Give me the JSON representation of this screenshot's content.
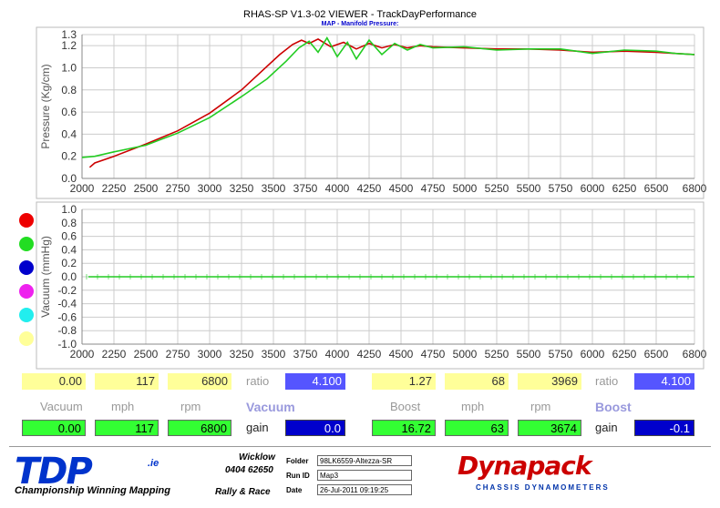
{
  "window": {
    "title": "RHAS-SP V1.3-02 VIEWER - TrackDayPerformance",
    "subtitle": "MAP - Manifold Pressure:"
  },
  "chart_data": [
    {
      "type": "line",
      "ylabel": "Pressure (Kg/cm)",
      "xlim": [
        2000,
        6800
      ],
      "ylim": [
        0.0,
        1.3
      ],
      "x_ticks": [
        2000,
        2250,
        2500,
        2750,
        3000,
        3250,
        3500,
        3750,
        4000,
        4250,
        4500,
        4750,
        5000,
        5250,
        5500,
        5750,
        6000,
        6250,
        6500,
        6800
      ],
      "y_ticks": [
        "0.0",
        "0.2",
        "0.4",
        "0.6",
        "0.8",
        "1.0",
        "1.2",
        "1.3"
      ],
      "y_tick_values": [
        0.0,
        0.2,
        0.4,
        0.6,
        0.8,
        1.0,
        1.2,
        1.3
      ],
      "grid": true,
      "series": [
        {
          "color": "#cc0000",
          "x": [
            2060,
            2100,
            2250,
            2500,
            2750,
            3000,
            3250,
            3400,
            3550,
            3650,
            3720,
            3780,
            3850,
            3950,
            4050,
            4150,
            4250,
            4350,
            4450,
            4550,
            4650,
            4750,
            5000,
            5250,
            5500,
            5750,
            6000,
            6250,
            6500,
            6650,
            6800
          ],
          "y": [
            0.1,
            0.14,
            0.2,
            0.31,
            0.43,
            0.59,
            0.8,
            0.96,
            1.12,
            1.21,
            1.25,
            1.22,
            1.26,
            1.19,
            1.23,
            1.17,
            1.22,
            1.18,
            1.21,
            1.18,
            1.2,
            1.19,
            1.18,
            1.17,
            1.17,
            1.16,
            1.14,
            1.15,
            1.14,
            1.13,
            1.12
          ]
        },
        {
          "color": "#22cc22",
          "x": [
            2000,
            2100,
            2250,
            2500,
            2750,
            3000,
            3250,
            3450,
            3600,
            3700,
            3780,
            3850,
            3920,
            4000,
            4080,
            4150,
            4250,
            4350,
            4450,
            4550,
            4650,
            4750,
            5000,
            5250,
            5500,
            5750,
            6000,
            6250,
            6500,
            6650,
            6800
          ],
          "y": [
            0.19,
            0.2,
            0.24,
            0.3,
            0.41,
            0.55,
            0.74,
            0.9,
            1.06,
            1.18,
            1.24,
            1.14,
            1.27,
            1.1,
            1.23,
            1.08,
            1.25,
            1.12,
            1.22,
            1.16,
            1.21,
            1.18,
            1.19,
            1.16,
            1.17,
            1.17,
            1.13,
            1.16,
            1.15,
            1.13,
            1.12
          ]
        }
      ]
    },
    {
      "type": "line",
      "ylabel": "Vacuum (mmHg)",
      "xlim": [
        2000,
        6800
      ],
      "ylim": [
        -1.0,
        1.0
      ],
      "x_ticks": [
        2000,
        2250,
        2500,
        2750,
        3000,
        3250,
        3500,
        3750,
        4000,
        4250,
        4500,
        4750,
        5000,
        5250,
        5500,
        5750,
        6000,
        6250,
        6500,
        6800
      ],
      "y_ticks": [
        "1.0",
        "0.8",
        "0.6",
        "0.4",
        "0.2",
        "0.0",
        "-0.2",
        "-0.4",
        "-0.6",
        "-0.8",
        "-1.0"
      ],
      "y_tick_values": [
        1.0,
        0.8,
        0.6,
        0.4,
        0.2,
        0.0,
        -0.2,
        -0.4,
        -0.6,
        -0.8,
        -1.0
      ],
      "grid": true,
      "series": [
        {
          "color": "#22cc22",
          "x": [
            2050,
            6800
          ],
          "y": [
            0.0,
            0.0
          ]
        }
      ]
    }
  ],
  "run_selectors": {
    "colors": [
      "#ee0000",
      "#22dd22",
      "#0000cc",
      "#ee22ee",
      "#22eeee",
      "#ffff99"
    ]
  },
  "readouts": {
    "top_row": {
      "vac_value": "0.00",
      "vac_mph": "117",
      "vac_rpm": "6800",
      "vac_ratio_label": "ratio",
      "vac_ratio": "4.100",
      "boost_value": "1.27",
      "boost_mph": "68",
      "boost_rpm": "3969",
      "boost_ratio_label": "ratio",
      "boost_ratio": "4.100"
    },
    "labels": {
      "vacuum": "Vacuum",
      "mph": "mph",
      "rpm": "rpm",
      "vacuum_title": "Vacuum",
      "boost": "Boost",
      "mph2": "mph",
      "rpm2": "rpm",
      "boost_title": "Boost"
    },
    "bottom_row": {
      "vac_value": "0.00",
      "vac_mph": "117",
      "vac_rpm": "6800",
      "vac_gain_label": "gain",
      "vac_gain": "0.0",
      "boost_value": "16.72",
      "boost_mph": "63",
      "boost_rpm": "3674",
      "boost_gain_label": "gain",
      "boost_gain": "-0.1"
    }
  },
  "footer": {
    "tdp_logo": "TDP",
    "tdp_ie": ".ie",
    "tagline": "Championship Winning Mapping",
    "tagline2": "Rally & Race",
    "contact_location": "Wicklow",
    "contact_phone": "0404 62650",
    "folder_label": "Folder",
    "folder_value": "98LK6559-Altezza-SR",
    "runid_label": "Run ID",
    "runid_value": "Map3",
    "date_label": "Date",
    "date_value": "26-Jul-2011  09:19:25",
    "dynapack_logo": "Dynapack",
    "dynapack_sub": "CHASSIS DYNAMOMETERS"
  }
}
